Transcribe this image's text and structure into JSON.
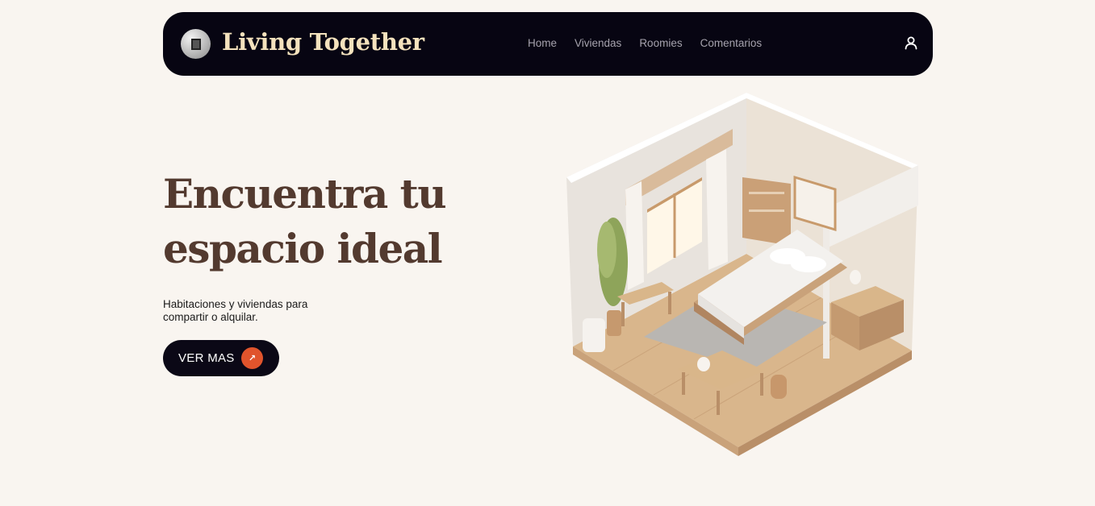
{
  "header": {
    "brand": "Living Together",
    "nav": [
      "Home",
      "Viviendas",
      "Roomies",
      "Comentarios"
    ]
  },
  "hero": {
    "title_line1": "Encuentra tu",
    "title_line2": "espacio ideal",
    "subtitle": "Habitaciones y viviendas para compartir o alquilar.",
    "cta_label": "VER MAS",
    "cta_icon": "arrow-icon"
  },
  "colors": {
    "background": "#f9f5f0",
    "navbar": "#070512",
    "brand": "#f4e2bd",
    "title": "#533a2f",
    "accent": "#e0542c"
  },
  "icons": {
    "logo": "logo-badge-icon",
    "user": "user-icon"
  }
}
